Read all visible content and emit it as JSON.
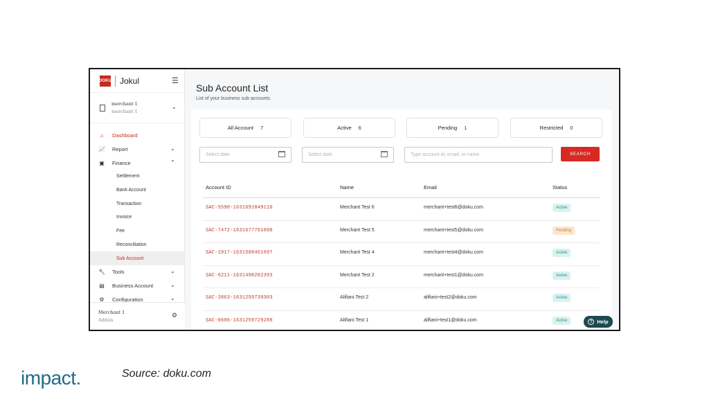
{
  "brand": {
    "logo_text": "DOKU",
    "name": "Jokul"
  },
  "account": {
    "name": "merchant 1",
    "sub": "merchant 1"
  },
  "nav": {
    "dashboard": "Dashboard",
    "report": "Report",
    "finance": "Finance",
    "finance_items": [
      "Settlement",
      "Bank Account",
      "Transaction",
      "Invoice",
      "Fee",
      "Reconciliation",
      "Sub Account"
    ],
    "tools": "Tools",
    "business_account": "Business Account",
    "configuration": "Configuration"
  },
  "footer": {
    "name": "Merchant 1",
    "role": "Admin"
  },
  "page": {
    "title": "Sub Account List",
    "subtitle": "List of your business sub accounts"
  },
  "tabs": [
    {
      "label": "All Account",
      "count": "7"
    },
    {
      "label": "Active",
      "count": "6"
    },
    {
      "label": "Pending",
      "count": "1"
    },
    {
      "label": "Restricted",
      "count": "0"
    }
  ],
  "filters": {
    "date1_placeholder": "Select date",
    "date2_placeholder": "Select date",
    "search_placeholder": "Type account id, email, or name",
    "search_button": "SEARCH"
  },
  "table": {
    "headers": [
      "Account ID",
      "Name",
      "Email",
      "Status"
    ],
    "rows": [
      {
        "id": "SAC-5590-1631691849116",
        "name": "Merchant Test 6",
        "email": "merchant+test6@doku.com",
        "status": "Active"
      },
      {
        "id": "SAC-7472-1631677761600",
        "name": "Merchant Test 5",
        "email": "merchant+test5@doku.com",
        "status": "Pending"
      },
      {
        "id": "SAC-1917-1631508461697",
        "name": "Merchant Test 4",
        "email": "merchant+test4@doku.com",
        "status": "Active"
      },
      {
        "id": "SAC-6211-1631498282393",
        "name": "Merchant Test 2",
        "email": "merchant+test1@doku.com",
        "status": "Active"
      },
      {
        "id": "SAC-3863-1631259739303",
        "name": "Alifiani Test 2",
        "email": "alifiani+test2@doku.com",
        "status": "Active"
      },
      {
        "id": "SAC-0606-1631259729288",
        "name": "Alifiani Test 1",
        "email": "alifiani+test1@doku.com",
        "status": "Active"
      }
    ]
  },
  "help": {
    "label": "Help"
  },
  "slide": {
    "logo": "impact.",
    "source": "Source: doku.com"
  },
  "colors": {
    "accent": "#d62a22",
    "active_badge_bg": "#d9f1f0",
    "active_badge_text": "#2a8f88",
    "pending_badge_bg": "#fde6cf",
    "pending_badge_text": "#c57a31",
    "help_bg": "#1c4a4f",
    "impact": "#1f6b86"
  }
}
